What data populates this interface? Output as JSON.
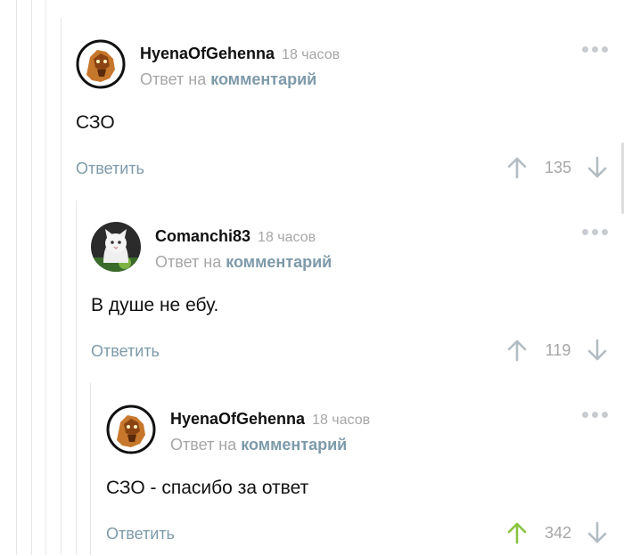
{
  "comments": [
    {
      "author": "HyenaOfGehenna",
      "time": "18 часов",
      "reply_prefix": "Ответ на",
      "reply_link": "комментарий",
      "text": "СЗО",
      "reply_label": "Ответить",
      "score": "135",
      "upvoted": false
    },
    {
      "author": "Comanchi83",
      "time": "18 часов",
      "reply_prefix": "Ответ на",
      "reply_link": "комментарий",
      "text": "В душе не ебу.",
      "reply_label": "Ответить",
      "score": "119",
      "upvoted": false
    },
    {
      "author": "HyenaOfGehenna",
      "time": "18 часов",
      "reply_prefix": "Ответ на",
      "reply_link": "комментарий",
      "text": "СЗО - спасибо за ответ",
      "reply_label": "Ответить",
      "score": "342",
      "upvoted": true
    }
  ],
  "colors": {
    "link": "#7d9aaa",
    "muted": "#a6a6a6",
    "upvote_active": "#8ac43f",
    "icon_default": "#b3bcc2",
    "thread_line": "#e6e6e6"
  },
  "icons": [
    "more-dots-icon",
    "arrow-up-icon",
    "arrow-down-icon",
    "avatar-hyena",
    "avatar-cat"
  ]
}
